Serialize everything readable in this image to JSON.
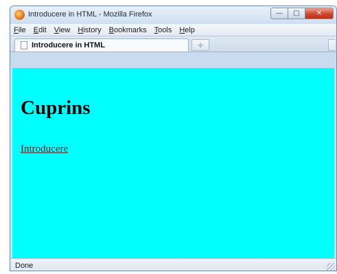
{
  "window": {
    "title": "Introducere in HTML - Mozilla Firefox",
    "icon": "firefox-icon",
    "controls": {
      "minimize": "minimize-icon",
      "maximize": "maximize-icon",
      "close": "close-icon"
    }
  },
  "menubar": {
    "items": [
      "File",
      "Edit",
      "View",
      "History",
      "Bookmarks",
      "Tools",
      "Help"
    ]
  },
  "tabs": {
    "active": {
      "label": "Introducere in HTML",
      "icon": "document-icon"
    },
    "new_tab_symbol": "+"
  },
  "page": {
    "background": "#00ffff",
    "heading": "Cuprins",
    "link": "Introducere"
  },
  "status": {
    "text": "Done"
  }
}
